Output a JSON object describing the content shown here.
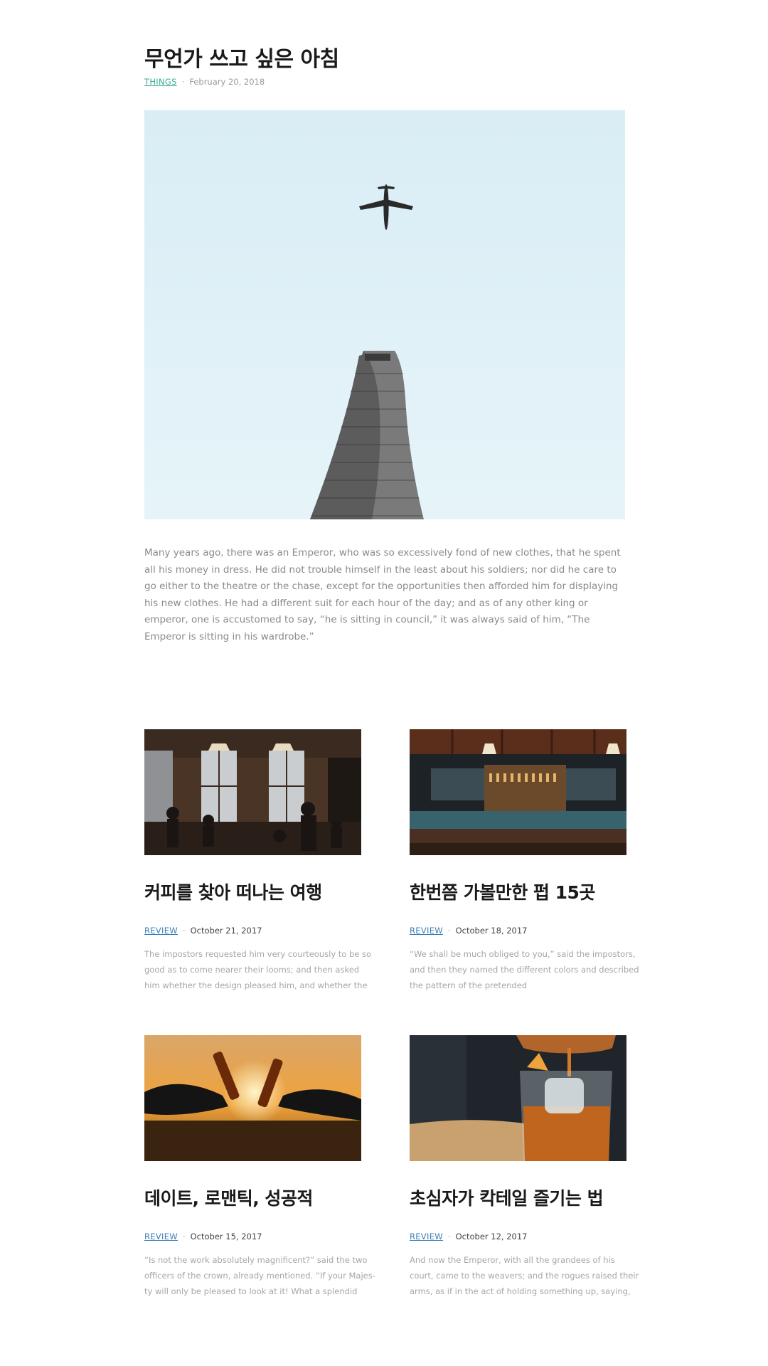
{
  "feature": {
    "title": "무언가 쓰고 싶은 아침",
    "category": "THINGS",
    "date": "February 20, 2018",
    "image": "airplane-over-skyscraper-photo",
    "excerpt": "Many years ago, there was an Emperor, who was so excessively fond of new clothes, that he spent all his money in dress. He did not trouble himself in the least about his soldiers; nor did he care to go either to the theatre or the chase, except for the opportunities then afforded him for displaying his new clothes. He had a different suit for each hour of the day; and as of any other king or emperor, one is accustomed to say, “he is sitting in council,” it was always said of him, “The Emperor is sitting in his wardrobe.”"
  },
  "posts": [
    {
      "title": "커피를 찾아 떠나는 여행",
      "category": "REVIEW",
      "date": "October 21, 2017",
      "image": "cafe-interior-photo",
      "excerpt": "The impostors requested him very courteously to be so good as to come nearer their looms; and then asked him whether the design pleased him, and whether the colors"
    },
    {
      "title": "한번쯤 가볼만한 펍 15곳",
      "category": "REVIEW",
      "date": "October 18, 2017",
      "image": "pub-bar-photo",
      "excerpt": "“We shall be much obliged to you,” said the impostors, and then they named the different colors and described the pattern of the pretended"
    },
    {
      "title": "데이트, 로맨틱, 성공적",
      "category": "REVIEW",
      "date": "October 15, 2017",
      "image": "beer-toast-sunset-photo",
      "excerpt": "“Is not the work absolutely magnificent?” said the two officers of the crown, already mentioned. “If your Majes-ty will only be pleased to look at it! What a splendid"
    },
    {
      "title": "초심자가 칵테일 즐기는 법",
      "category": "REVIEW",
      "date": "October 12, 2017",
      "image": "cocktail-pour-photo",
      "excerpt": "And now the Emperor, with all the grandees of his court, came to the weavers; and the rogues raised their arms, as if in the act of holding something up, saying, “Here are your"
    }
  ]
}
